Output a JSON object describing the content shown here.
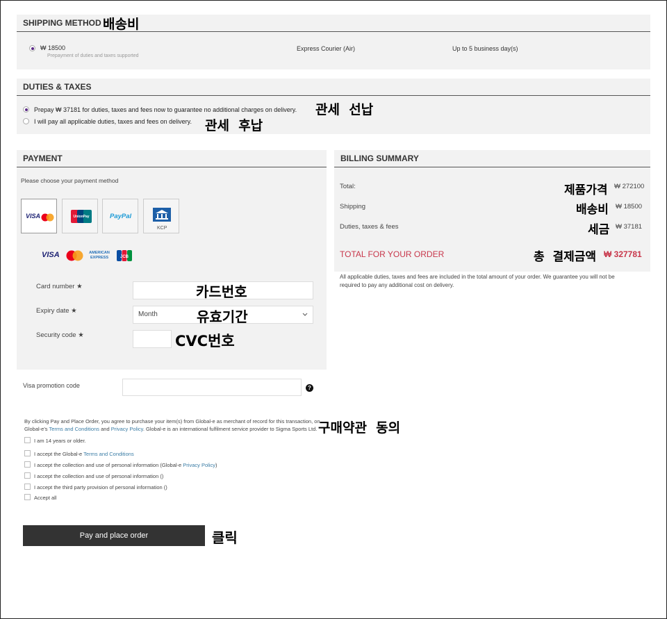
{
  "shipping": {
    "title": "SHIPPING METHOD",
    "annotation": "배송비",
    "price": "₩ 18500",
    "note": "Prepayment of duties and taxes supported",
    "carrier": "Express Courier (Air)",
    "eta": "Up to 5 business day(s)"
  },
  "duties": {
    "title": "DUTIES & TAXES",
    "option_prepay": "Prepay ₩ 37181 for duties, taxes and fees now to guarantee no additional charges on delivery.",
    "option_prepay_annotation": "관세  선납",
    "option_later": "I will pay all applicable duties, taxes and fees on delivery.",
    "option_later_annotation": "관세  후납"
  },
  "payment": {
    "title": "PAYMENT",
    "instruction": "Please choose your payment method",
    "methods": {
      "visa_mc": "VISA",
      "unionpay": "UnionPay",
      "paypal": "PayPal",
      "kcp": "KCP"
    },
    "brand_visa": "VISA",
    "brand_amex_1": "AMERICAN",
    "brand_amex_2": "EXPRESS",
    "brand_jcb": "JCB",
    "card_number_label": "Card number ★",
    "card_number_annotation": "카드번호",
    "expiry_label": "Expiry date ★",
    "expiry_value": "Month",
    "expiry_annotation": "유효기간",
    "security_label": "Security code ★",
    "security_annotation": "CVC번호"
  },
  "promo": {
    "label": "Visa promotion code",
    "help_icon": "?"
  },
  "terms": {
    "text_1": "By clicking Pay and Place Order, you agree to purchase your item(s) from Global-e as merchant of record for this transaction, on",
    "text_2a": "Global-e's ",
    "terms_link": "Terms and Conditions",
    "text_2b": " and ",
    "privacy_link": "Privacy Policy",
    "text_2c": ". Global-e is an international fulfilment service provider to Sigma Sports Ltd.",
    "annotation": "구매약관  동의",
    "checks": {
      "age": "I am 14 years or older.",
      "accept_tc_pre": "I accept the Global-e ",
      "accept_tc_link": "Terms and Conditions",
      "collect_pre": "I accept the collection and use of personal information (Global-e ",
      "collect_link": "Privacy Policy",
      "collect_post": ")",
      "collect2": "I accept the collection and use of personal information ()",
      "third_party": "I accept the third party provision of personal information ()",
      "accept_all": "Accept all"
    }
  },
  "order_button": {
    "label": "Pay and place order",
    "annotation": "클릭"
  },
  "billing": {
    "title": "BILLING SUMMARY",
    "total_label": "Total:",
    "total_annotation": "제품가격",
    "total_value": "₩ 272100",
    "shipping_label": "Shipping",
    "shipping_annotation": "배송비",
    "shipping_value": "₩ 18500",
    "duties_label": "Duties, taxes & fees",
    "duties_annotation": "세금",
    "duties_value": "₩ 37181",
    "order_total_label": "TOTAL FOR YOUR ORDER",
    "order_total_annotation": "총  결제금액",
    "order_total_value": "₩ 327781",
    "disclaimer_1": "All applicable duties, taxes and fees are included in the total amount of your order. We guarantee you will not be",
    "disclaimer_2": "required to pay any additional cost on delivery."
  },
  "colors": {
    "accent_red": "#c8374b",
    "radio_purple": "#5b2a86",
    "button_dark": "#333333",
    "link_blue": "#3a7ca5"
  }
}
